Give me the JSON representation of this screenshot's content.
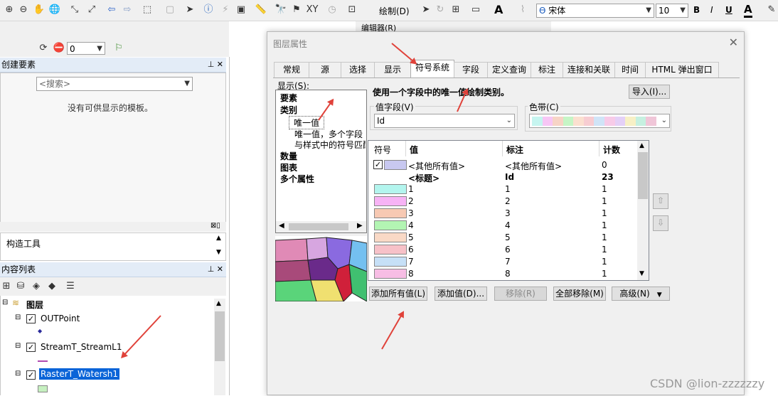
{
  "toolbar": {
    "draw_label": "绘制(D)",
    "font_name": "宋体",
    "font_size": "10",
    "bold": "B",
    "italic": "I",
    "underline": "U",
    "font_color": "A",
    "text_tool": "A",
    "editor_label": "编辑器(R)",
    "spin_value": "0"
  },
  "left_panel": {
    "create_features_title": "创建要素",
    "search_placeholder": "<搜索>",
    "no_templates": "没有可供显示的模板。",
    "construct_tools": "构造工具",
    "toc_title": "内容列表",
    "layers_root": "图层",
    "layers": [
      {
        "name": "OUTPoint"
      },
      {
        "name": "StreamT_StreamL1"
      },
      {
        "name": "RasterT_Watersh1"
      }
    ]
  },
  "dialog": {
    "title": "图层属性",
    "tabs": [
      "常规",
      "源",
      "选择",
      "显示",
      "符号系统",
      "字段",
      "定义查询",
      "标注",
      "连接和关联",
      "时间",
      "HTML 弹出窗口"
    ],
    "active_tab": "符号系统",
    "show_label": "显示(S):",
    "show_items": [
      "要素",
      "类别",
      "唯一值",
      "唯一值，多个字段",
      "与样式中的符号匹配",
      "数量",
      "图表",
      "多个属性"
    ],
    "description": "使用一个字段中的唯一值绘制类别。",
    "import_button": "导入(I)...",
    "value_field_label": "值字段(V)",
    "value_field_value": "Id",
    "color_ramp_label": "色带(C)",
    "columns": {
      "symbol": "符号",
      "value": "值",
      "label": "标注",
      "count": "计数"
    },
    "rows": [
      {
        "value": "<其他所有值>",
        "label": "<其他所有值>",
        "count": "0",
        "color": "#c8c8f0",
        "checked": true
      },
      {
        "value": "<标题>",
        "label": "Id",
        "count": "23",
        "heading": true
      },
      {
        "value": "1",
        "label": "1",
        "count": "1",
        "color": "#b3f5ee"
      },
      {
        "value": "2",
        "label": "2",
        "count": "1",
        "color": "#f7b3f5"
      },
      {
        "value": "3",
        "label": "3",
        "count": "1",
        "color": "#f7c9b3"
      },
      {
        "value": "4",
        "label": "4",
        "count": "1",
        "color": "#b3f5b3"
      },
      {
        "value": "5",
        "label": "5",
        "count": "1",
        "color": "#f9d9c6"
      },
      {
        "value": "6",
        "label": "6",
        "count": "1",
        "color": "#f7c1c8"
      },
      {
        "value": "7",
        "label": "7",
        "count": "1",
        "color": "#c6e0f7"
      },
      {
        "value": "8",
        "label": "8",
        "count": "1",
        "color": "#f7bde4"
      }
    ],
    "buttons": {
      "add_all": "添加所有值(L)",
      "add_values": "添加值(D)...",
      "remove": "移除(R)",
      "remove_all": "全部移除(M)",
      "advanced": "高级(N)"
    },
    "ramp_colors": [
      "#c6f5f0",
      "#f7c6f5",
      "#f7d4c6",
      "#c6f5c6",
      "#fbe0d0",
      "#f7cdd2",
      "#d0e4f7",
      "#f7cbe8",
      "#e4d0f7",
      "#f7f0c6",
      "#c6f0e0",
      "#f0c6d8"
    ]
  },
  "watermark": "CSDN @lion-zzzzzzy"
}
